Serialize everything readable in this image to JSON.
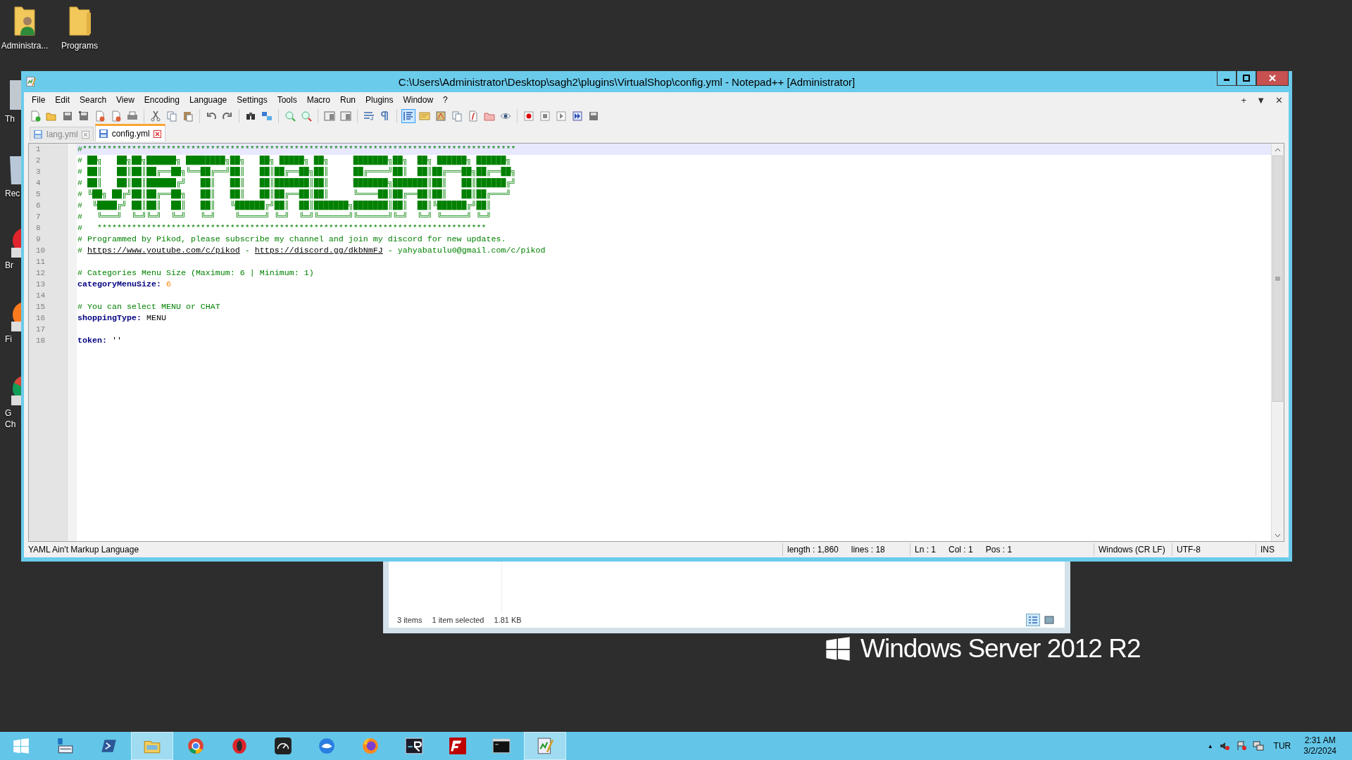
{
  "desktop_icons": [
    {
      "label": "Administra..."
    },
    {
      "label": "Programs"
    }
  ],
  "partial_desktop_icons": [
    {
      "lines": [
        "Th"
      ]
    },
    {
      "lines": [
        "Rec"
      ]
    },
    {
      "lines": [
        "Br"
      ]
    },
    {
      "lines": [
        "Fi"
      ]
    },
    {
      "lines": [
        "G",
        "Ch"
      ]
    }
  ],
  "window": {
    "title": "C:\\Users\\Administrator\\Desktop\\sagh2\\plugins\\VirtualShop\\config.yml - Notepad++ [Administrator]"
  },
  "menu": [
    "File",
    "Edit",
    "Search",
    "View",
    "Encoding",
    "Language",
    "Settings",
    "Tools",
    "Macro",
    "Run",
    "Plugins",
    "Window",
    "?"
  ],
  "menu_right": [
    "+",
    "▼",
    "✕"
  ],
  "toolbar": [
    {
      "buttons": [
        {
          "selected": false
        },
        {
          "selected": false
        },
        {
          "selected": false
        },
        {
          "selected": false
        },
        {
          "selected": false
        },
        {
          "selected": false
        },
        {
          "selected": false
        }
      ]
    },
    {
      "buttons": [
        {
          "selected": false
        },
        {
          "selected": false
        },
        {
          "selected": false
        }
      ]
    },
    {
      "buttons": [
        {
          "selected": false
        },
        {
          "selected": false
        }
      ]
    },
    {
      "buttons": [
        {
          "selected": false
        },
        {
          "selected": false
        }
      ]
    },
    {
      "buttons": [
        {
          "selected": false
        },
        {
          "selected": false
        }
      ]
    },
    {
      "buttons": [
        {
          "selected": false
        },
        {
          "selected": false
        }
      ]
    },
    {
      "buttons": [
        {
          "selected": false
        },
        {
          "selected": false
        }
      ]
    },
    {
      "buttons": [
        {
          "selected": true
        },
        {
          "selected": false
        },
        {
          "selected": false
        },
        {
          "selected": false
        },
        {
          "selected": false
        },
        {
          "selected": false
        },
        {
          "selected": false
        }
      ]
    },
    {
      "buttons": [
        {
          "selected": false
        },
        {
          "selected": false
        },
        {
          "selected": false
        },
        {
          "selected": false
        },
        {
          "selected": false
        }
      ]
    }
  ],
  "tabs": [
    {
      "label": "lang.yml",
      "selected": false
    },
    {
      "label": "config.yml",
      "selected": true
    }
  ],
  "lines": [
    {
      "number": "1",
      "current": true,
      "segments": [
        {
          "kind": "comment",
          "text": "#****************************************************************************************"
        }
      ]
    },
    {
      "number": "2",
      "current": false,
      "segments": [
        {
          "kind": "comment",
          "text": "# ██╗   ██╗██╗██████╗ ████████╗██╗   ██╗ █████╗ ██╗     ███████╗██╗  ██╗ ██████╗ ██████╗"
        }
      ]
    },
    {
      "number": "3",
      "current": false,
      "segments": [
        {
          "kind": "comment",
          "text": "# ██║   ██║██║██╔══██╗╚══██╔══╝██║   ██║██╔══██╗██║     ██╔════╝██║  ██║██╔═══██╗██╔══██╗"
        }
      ]
    },
    {
      "number": "4",
      "current": false,
      "segments": [
        {
          "kind": "comment",
          "text": "# ██║   ██║██║██████╔╝   ██║   ██║   ██║███████║██║     ███████╗███████║██║   ██║██████╔╝"
        }
      ]
    },
    {
      "number": "5",
      "current": false,
      "segments": [
        {
          "kind": "comment",
          "text": "# ╚██╗ ██╔╝██║██╔══██╗   ██║   ██║   ██║██╔══██║██║     ╚════██║██╔══██║██║   ██║██╔═══╝"
        }
      ]
    },
    {
      "number": "6",
      "current": false,
      "segments": [
        {
          "kind": "comment",
          "text": "#  ╚████╔╝ ██║██║  ██║   ██║   ╚██████╔╝██║  ██║███████╗███████║██║  ██║╚██████╔╝██║"
        }
      ]
    },
    {
      "number": "7",
      "current": false,
      "segments": [
        {
          "kind": "comment",
          "text": "#   ╚═══╝  ╚═╝╚═╝  ╚═╝   ╚═╝    ╚═════╝ ╚═╝  ╚═╝╚══════╝╚══════╝╚═╝  ╚═╝ ╚═════╝ ╚═╝"
        }
      ]
    },
    {
      "number": "8",
      "current": false,
      "segments": [
        {
          "kind": "comment",
          "text": "#   *******************************************************************************"
        }
      ]
    },
    {
      "number": "9",
      "current": false,
      "segments": [
        {
          "kind": "comment",
          "text": "# Programmed by Pikod, please subscribe my channel and join my discord for new updates."
        }
      ]
    },
    {
      "number": "10",
      "current": false,
      "segments": [
        {
          "kind": "comment",
          "text": "# "
        },
        {
          "kind": "link",
          "text": "https://www.youtube.com/c/pikod"
        },
        {
          "kind": "comment",
          "text": " - "
        },
        {
          "kind": "link",
          "text": "https://discord.gg/dkbNmFJ"
        },
        {
          "kind": "comment",
          "text": " - yahyabatulu0@gmail.com/c/pikod"
        }
      ]
    },
    {
      "number": "11",
      "current": false
    },
    {
      "number": "12",
      "current": false,
      "segments": [
        {
          "kind": "comment",
          "text": "# Categories Menu Size (Maximum: 6 | Minimum: 1)"
        }
      ]
    },
    {
      "number": "13",
      "current": false,
      "segments": [
        {
          "kind": "key",
          "text": "categoryMenuSize:"
        },
        {
          "kind": "number",
          "text": " 6"
        }
      ]
    },
    {
      "number": "14",
      "current": false
    },
    {
      "number": "15",
      "current": false,
      "segments": [
        {
          "kind": "comment",
          "text": "# You can select MENU or CHAT"
        }
      ]
    },
    {
      "number": "16",
      "current": false,
      "segments": [
        {
          "kind": "key",
          "text": "shoppingType:"
        },
        {
          "kind": "plain",
          "text": " MENU"
        }
      ]
    },
    {
      "number": "17",
      "current": false
    },
    {
      "number": "18",
      "current": false,
      "segments": [
        {
          "kind": "key",
          "text": "token:"
        },
        {
          "kind": "plain",
          "text": " ''"
        }
      ]
    }
  ],
  "status_bar": {
    "language": "YAML Ain't Markup Language",
    "length": "length : 1,860",
    "lines": "lines : 18",
    "ln": "Ln : 1",
    "col": "Col : 1",
    "pos": "Pos : 1",
    "eol": "Windows (CR LF)",
    "encoding": "UTF-8",
    "mode": "INS"
  },
  "explorer_status": {
    "items": "3 items",
    "selection": "1 item selected",
    "size": "1.81 KB",
    "views": [
      {
        "selected": true
      },
      {
        "selected": false
      }
    ]
  },
  "branding": "Windows Server 2012 R2",
  "taskbar": {
    "items": [
      {
        "selected": false
      },
      {
        "selected": false
      },
      {
        "selected": false
      },
      {
        "selected": true
      },
      {
        "selected": false
      },
      {
        "selected": false
      },
      {
        "selected": false
      },
      {
        "selected": false
      },
      {
        "selected": false
      },
      {
        "selected": false
      },
      {
        "selected": false
      },
      {
        "selected": false
      },
      {
        "selected": true
      }
    ],
    "tray": {
      "arrow": "▲",
      "language": "TUR",
      "time": "2:31 AM",
      "date": "3/2/2024"
    }
  }
}
